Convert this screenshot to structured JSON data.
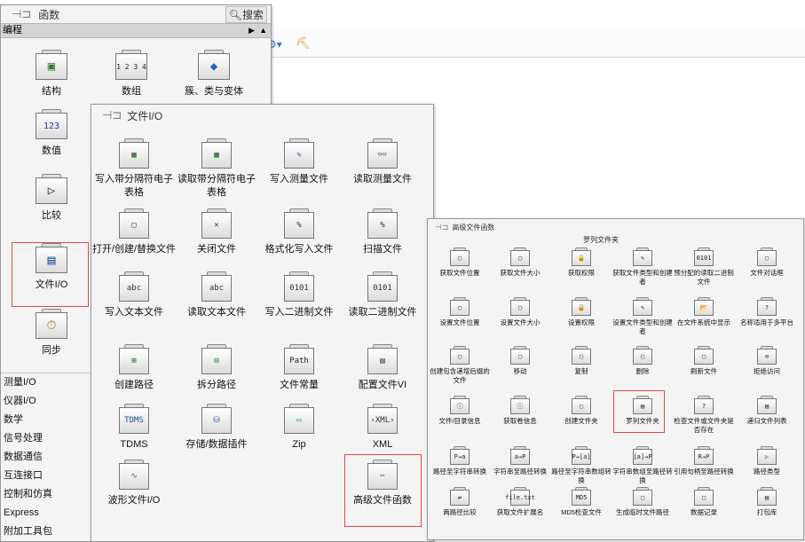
{
  "main_palette": {
    "title": "函数",
    "search_label": "搜索",
    "category": "编程",
    "icons": [
      {
        "label": "结构",
        "glyph": "▣"
      },
      {
        "label": "数组",
        "glyph": "1 2 3 4"
      },
      {
        "label": "簇、类与变体",
        "glyph": "◆"
      },
      {
        "label": "数值",
        "glyph": "123"
      },
      {
        "label": "比较",
        "glyph": "▷"
      },
      {
        "label": "文件I/O",
        "glyph": "▤"
      },
      {
        "label": "同步",
        "glyph": "⏱"
      }
    ],
    "side_list": [
      "测量I/O",
      "仪器I/O",
      "数学",
      "信号处理",
      "数据通信",
      "互连接口",
      "控制和仿真",
      "Express",
      "附加工具包"
    ]
  },
  "file_io_palette": {
    "title": "文件I/O",
    "icons": [
      {
        "label": "写入带分隔符电子表格",
        "glyph": "▦"
      },
      {
        "label": "读取带分隔符电子表格",
        "glyph": "▦"
      },
      {
        "label": "写入测量文件",
        "glyph": "✎"
      },
      {
        "label": "读取测量文件",
        "glyph": "👓"
      },
      {
        "label": "打开/创建/替换文件",
        "glyph": "▢"
      },
      {
        "label": "关闭文件",
        "glyph": "✕"
      },
      {
        "label": "格式化写入文件",
        "glyph": "%"
      },
      {
        "label": "扫描文件",
        "glyph": "%"
      },
      {
        "label": "写入文本文件",
        "glyph": "abc"
      },
      {
        "label": "读取文本文件",
        "glyph": "abc"
      },
      {
        "label": "写入二进制文件",
        "glyph": "0101"
      },
      {
        "label": "读取二进制文件",
        "glyph": "0101"
      },
      {
        "label": "创建路径",
        "glyph": "⊞"
      },
      {
        "label": "拆分路径",
        "glyph": "⊟"
      },
      {
        "label": "文件常量",
        "glyph": "Path"
      },
      {
        "label": "配置文件VI",
        "glyph": "▤"
      },
      {
        "label": "TDMS",
        "glyph": "TDMS"
      },
      {
        "label": "存储/数据插件",
        "glyph": "⛁"
      },
      {
        "label": "Zip",
        "glyph": "▭"
      },
      {
        "label": "XML",
        "glyph": "‹XML›"
      },
      {
        "label": "波形文件I/O",
        "glyph": "∿"
      },
      {
        "label": "高级文件函数",
        "glyph": "✂"
      }
    ]
  },
  "advanced_palette": {
    "title": "高级文件函数",
    "tooltip": "罗列文件夹",
    "icons": [
      {
        "label": "获取文件位置",
        "glyph": "▢"
      },
      {
        "label": "获取文件大小",
        "glyph": "▢"
      },
      {
        "label": "获取权限",
        "glyph": "🔒"
      },
      {
        "label": "获取文件类型和创建者",
        "glyph": "✎"
      },
      {
        "label": "预分配的读取二进制文件",
        "glyph": "0101"
      },
      {
        "label": "文件对话框",
        "glyph": "▢"
      },
      {
        "label": "设置文件位置",
        "glyph": "▢"
      },
      {
        "label": "设置文件大小",
        "glyph": "▢"
      },
      {
        "label": "设置权限",
        "glyph": "🔒"
      },
      {
        "label": "设置文件类型和创建者",
        "glyph": "✎"
      },
      {
        "label": "在文件系统中显示",
        "glyph": "📂"
      },
      {
        "label": "名称适用于多平台",
        "glyph": "?"
      },
      {
        "label": "创建包含递增后缀的文件",
        "glyph": "▢"
      },
      {
        "label": "移动",
        "glyph": "▢"
      },
      {
        "label": "复制",
        "glyph": "▢"
      },
      {
        "label": "删除",
        "glyph": "▢"
      },
      {
        "label": "刷新文件",
        "glyph": "▢"
      },
      {
        "label": "拒绝访问",
        "glyph": "⊖"
      },
      {
        "label": "文件/目录信息",
        "glyph": "ⓘ"
      },
      {
        "label": "获取卷信息",
        "glyph": "ⓘ"
      },
      {
        "label": "创建文件夹",
        "glyph": "▢"
      },
      {
        "label": "罗列文件夹",
        "glyph": "▤"
      },
      {
        "label": "检查文件或文件夹是否存在",
        "glyph": "?"
      },
      {
        "label": "递归文件列表",
        "glyph": "▤"
      },
      {
        "label": "路径至字符串转换",
        "glyph": "P→a"
      },
      {
        "label": "字符串至路径转换",
        "glyph": "a→P"
      },
      {
        "label": "路径至字符串数组转换",
        "glyph": "P→[a]"
      },
      {
        "label": "字符串数组至路径转换",
        "glyph": "[a]→P"
      },
      {
        "label": "引用句柄至路径转换",
        "glyph": "R→P"
      },
      {
        "label": "路径类型",
        "glyph": "▷"
      },
      {
        "label": "两路径比较",
        "glyph": "⇄"
      },
      {
        "label": "获取文件扩展名",
        "glyph": "file.txt"
      },
      {
        "label": "MD5检查文件",
        "glyph": "MD5"
      },
      {
        "label": "生成临时文件路径",
        "glyph": "▢"
      },
      {
        "label": "数据记录",
        "glyph": "▢"
      },
      {
        "label": "打包库",
        "glyph": "▤"
      }
    ]
  }
}
